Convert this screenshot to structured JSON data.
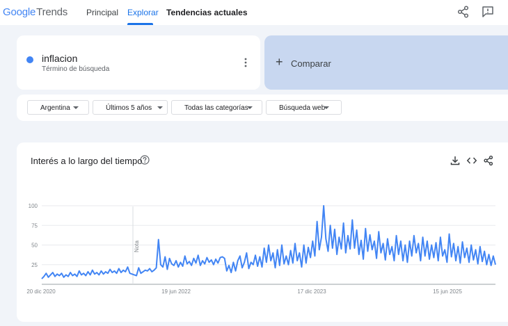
{
  "header": {
    "logo": {
      "google": "Google",
      "trends": "Trends"
    },
    "tabs": [
      {
        "label": "Principal"
      },
      {
        "label": "Explorar"
      },
      {
        "label": "Tendencias actuales"
      }
    ],
    "icons": [
      "share-icon",
      "feedback-icon"
    ]
  },
  "term": {
    "name": "inflacion",
    "type": "Término de búsqueda",
    "color": "#4285f4"
  },
  "compare": {
    "label": "Comparar",
    "plus": "+"
  },
  "filters": [
    {
      "label": "Argentina"
    },
    {
      "label": "Últimos 5 años"
    },
    {
      "label": "Todas las categorías"
    },
    {
      "label": "Búsqueda web"
    }
  ],
  "chart": {
    "title": "Interés a lo largo del tiempo",
    "note": "Nota",
    "icons": [
      "download-icon",
      "embed-icon",
      "share-icon"
    ]
  },
  "chart_data": {
    "type": "line",
    "title": "Interés a lo largo del tiempo",
    "ylim": [
      0,
      100
    ],
    "yticks": [
      25,
      50,
      75,
      100
    ],
    "grid": true,
    "xtick_labels": [
      "20 dic 2020",
      "19 jun 2022",
      "17 dic 2023",
      "15 jun 2025"
    ],
    "series": [
      {
        "name": "inflacion",
        "color": "#4285f4",
        "values": [
          7,
          10,
          14,
          9,
          12,
          15,
          10,
          13,
          11,
          14,
          9,
          12,
          10,
          15,
          11,
          13,
          10,
          17,
          12,
          14,
          11,
          16,
          12,
          18,
          13,
          15,
          12,
          17,
          13,
          16,
          14,
          19,
          15,
          17,
          14,
          20,
          15,
          18,
          16,
          22,
          14,
          13,
          12,
          11,
          21,
          14,
          16,
          18,
          17,
          20,
          16,
          18,
          21,
          57,
          25,
          22,
          35,
          19,
          33,
          26,
          24,
          30,
          22,
          28,
          23,
          36,
          26,
          29,
          24,
          33,
          27,
          37,
          24,
          30,
          26,
          34,
          28,
          31,
          25,
          32,
          27,
          34,
          35,
          33,
          17,
          24,
          15,
          28,
          17,
          30,
          36,
          21,
          28,
          40,
          20,
          28,
          25,
          37,
          23,
          35,
          22,
          46,
          28,
          50,
          30,
          40,
          21,
          44,
          24,
          50,
          26,
          36,
          25,
          43,
          27,
          52,
          30,
          40,
          22,
          50,
          27,
          47,
          34,
          55,
          36,
          80,
          44,
          60,
          100,
          58,
          42,
          75,
          46,
          70,
          38,
          60,
          45,
          78,
          40,
          62,
          45,
          82,
          46,
          69,
          38,
          56,
          32,
          71,
          42,
          63,
          44,
          55,
          33,
          67,
          40,
          52,
          31,
          58,
          38,
          48,
          30,
          62,
          38,
          55,
          30,
          50,
          28,
          55,
          36,
          62,
          40,
          52,
          30,
          60,
          36,
          55,
          32,
          50,
          34,
          53,
          30,
          60,
          36,
          44,
          28,
          64,
          35,
          52,
          30,
          48,
          27,
          54,
          34,
          46,
          28,
          50,
          31,
          44,
          26,
          48,
          29,
          42,
          25,
          38,
          24,
          36,
          25
        ]
      }
    ]
  }
}
